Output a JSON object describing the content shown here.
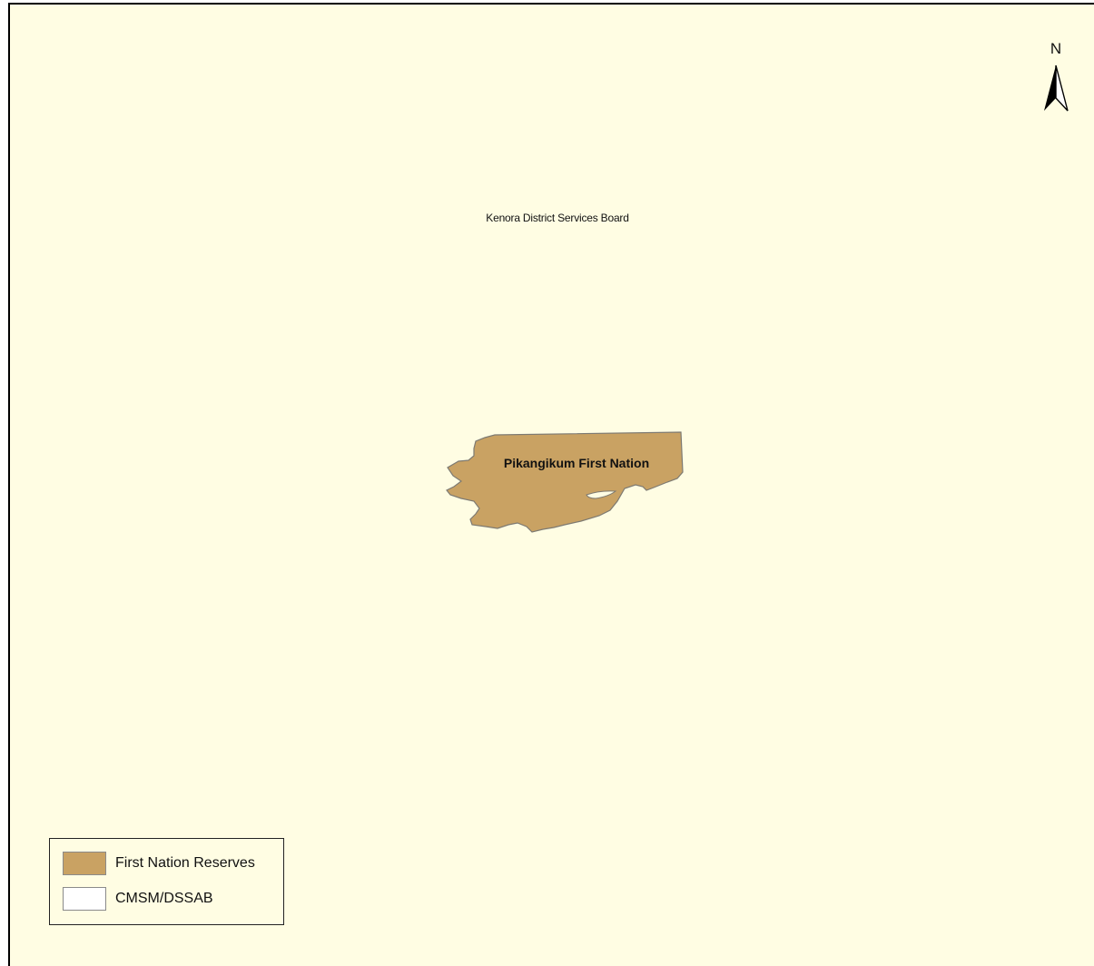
{
  "map": {
    "region_label": "Kenora District Services Board",
    "reserve_label": "Pikangikum First Nation",
    "background_color": "#fffde3",
    "reserve_color": "#c9a263"
  },
  "north_arrow": {
    "letter": "N",
    "icon": "north-arrow-icon"
  },
  "legend": {
    "items": [
      {
        "label": "First Nation Reserves",
        "color": "#c9a263"
      },
      {
        "label": "CMSM/DSSAB",
        "color": "#ffffff"
      }
    ]
  }
}
